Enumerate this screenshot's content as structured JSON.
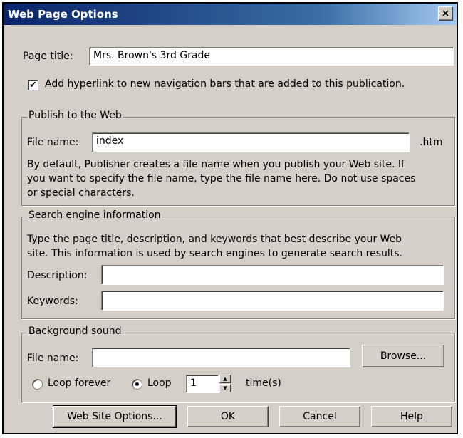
{
  "window": {
    "title": "Web Page Options",
    "close_glyph": "×"
  },
  "page_title": {
    "label": "Page title:",
    "value": "Mrs. Brown's 3rd Grade"
  },
  "nav_checkbox": {
    "checked": true,
    "label": "Add hyperlink to new navigation bars that are added to this publication."
  },
  "publish": {
    "heading": "Publish to the Web",
    "file_label": "File name:",
    "file_value": "index",
    "ext": ".htm",
    "help_lines": [
      "By default, Publisher creates a file name when you publish your Web site. If",
      "you want to specify the file name, type the file name here. Do not use spaces",
      "or special characters."
    ]
  },
  "search": {
    "heading": "Search engine information",
    "help_lines": [
      "Type the page title, description, and keywords that best describe your Web",
      "site. This information is used by search engines to generate search results."
    ],
    "description_label": "Description:",
    "description_value": "",
    "keywords_label": "Keywords:",
    "keywords_value": ""
  },
  "sound": {
    "heading": "Background sound",
    "file_label": "File name:",
    "file_value": "",
    "browse_label": "Browse...",
    "loop_forever_label": "Loop forever",
    "loop_label": "Loop",
    "loop_count": "1",
    "times_label": "time(s)",
    "selected_option": "Loop"
  },
  "footer": {
    "site_options": "Web Site Options...",
    "ok": "OK",
    "cancel": "Cancel",
    "help": "Help"
  }
}
